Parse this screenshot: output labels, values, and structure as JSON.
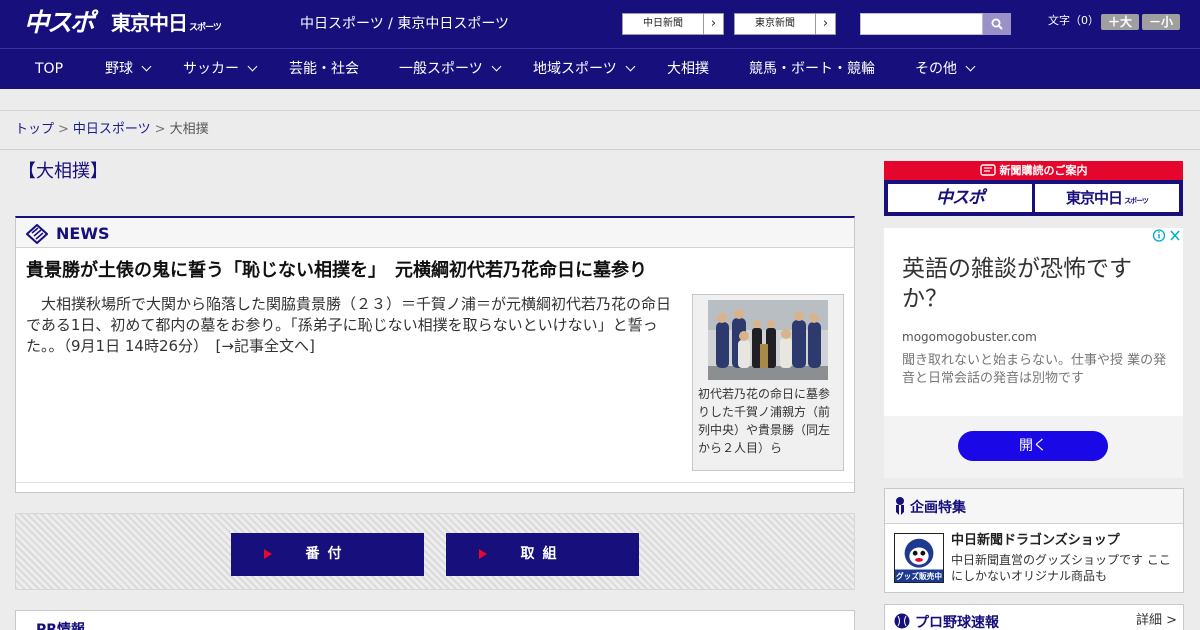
{
  "header": {
    "logo_chuspo": "中スポ",
    "logo_tokyo": "東京中日",
    "logo_tokyo_small": "スポーツ",
    "site_title": "中日スポーツ / 東京中日スポーツ",
    "paper_links": [
      "中日新聞",
      "東京新聞"
    ],
    "search": {
      "placeholder": ""
    },
    "font_size_label": "文字（0）",
    "font_larger": "＋大",
    "font_smaller": "－小"
  },
  "nav": {
    "items": [
      {
        "label": "TOP"
      },
      {
        "label": "野球"
      },
      {
        "label": "サッカー"
      },
      {
        "label": "芸能・社会"
      },
      {
        "label": "一般スポーツ"
      },
      {
        "label": "地域スポーツ"
      },
      {
        "label": "大相撲"
      },
      {
        "label": "競馬・ボート・競輪"
      },
      {
        "label": "その他"
      }
    ]
  },
  "breadcrumb": {
    "top": "トップ",
    "section": "中日スポーツ",
    "current": "大相撲",
    "separator": ">"
  },
  "page": {
    "heading": "【大相撲】"
  },
  "news": {
    "label": "NEWS",
    "title": "貴景勝が土俵の鬼に誓う「恥じない相撲を」　元横綱初代若乃花命日に墓参り",
    "body": "大相撲秋場所で大関から陥落した関脇貴景勝（２３）＝千賀ノ浦＝が元横綱初代若乃花の命日である1日、初めて都内の墓をお参り。「孫弟子に恥じない相撲を取らないといけない」と誓った。。（9月1日 14時26分）　[→記事全文へ]",
    "photo_caption": "初代若乃花の命日に墓参りした千賀ノ浦親方（前列中央）や貴景勝（同左から２人目）ら"
  },
  "sumo_buttons": {
    "banzuke": "番付",
    "torikumi": "取組"
  },
  "pr": {
    "label": "PR情報"
  },
  "subscribe": {
    "heading": "新聞購読のご案内",
    "logo_chuspo": "中スポ",
    "logo_tokyo": "東京中日",
    "logo_tokyo_small": "スポーツ"
  },
  "ad": {
    "title": "英語の雑談が恐怖ですか？",
    "domain": "mogomogobuster.com",
    "description": "聞き取れないと始まらない。仕事や授 業の発音と日常会話の発音は別物です",
    "cta": "開く"
  },
  "feature": {
    "label": "企画特集",
    "item_title": "中日新聞ドラゴンズショップ",
    "item_desc": "中日新聞直営のグッズショップです ここにしかないオリジナル商品も",
    "badge": "グッズ販売中"
  },
  "probase": {
    "label": "プロ野球速報",
    "more": "詳細 >"
  },
  "colors": {
    "brand_navy": "#160f7c",
    "accent_red": "#e4062d",
    "ad_blue": "#1a08e6"
  }
}
